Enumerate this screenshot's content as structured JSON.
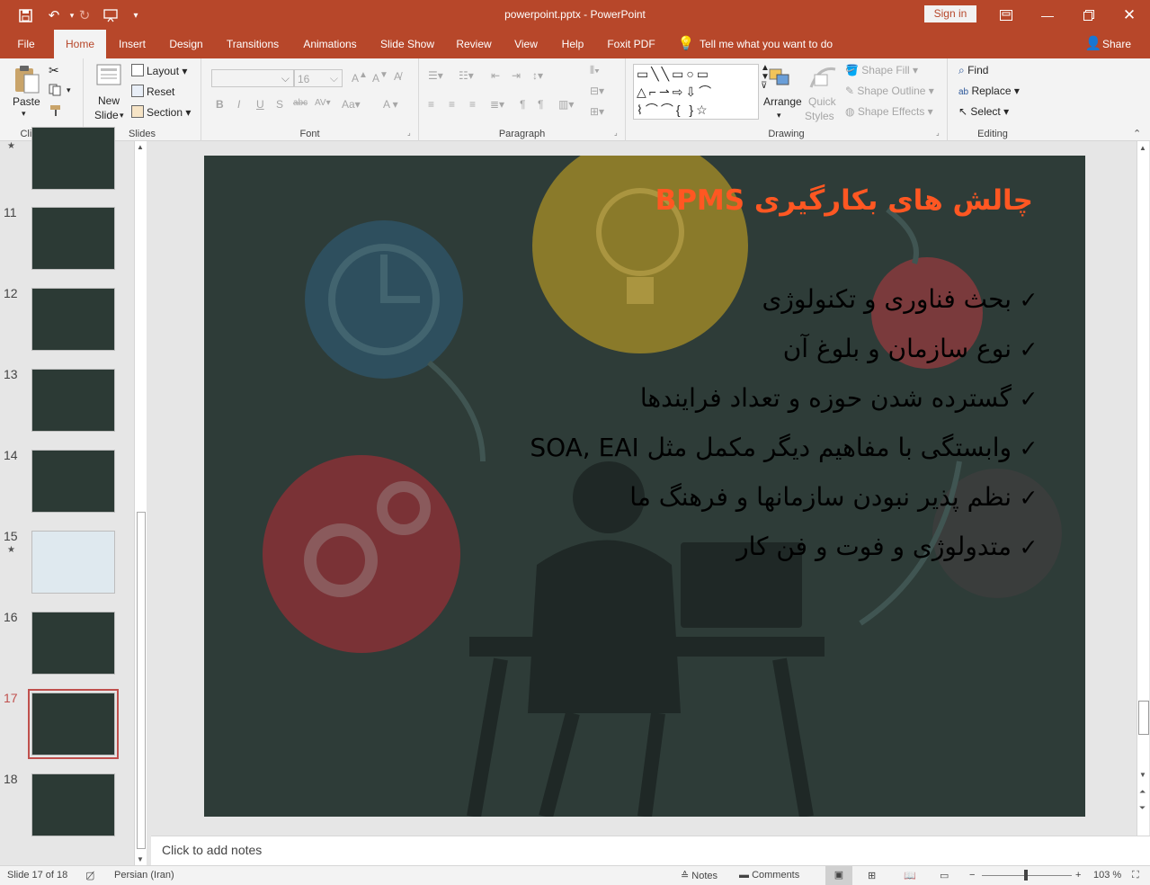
{
  "window": {
    "title": "powerpoint.pptx  -  PowerPoint",
    "sign_in": "Sign in"
  },
  "tabs": [
    {
      "label": "File"
    },
    {
      "label": "Home"
    },
    {
      "label": "Insert"
    },
    {
      "label": "Design"
    },
    {
      "label": "Transitions"
    },
    {
      "label": "Animations"
    },
    {
      "label": "Slide Show"
    },
    {
      "label": "Review"
    },
    {
      "label": "View"
    },
    {
      "label": "Help"
    },
    {
      "label": "Foxit PDF"
    }
  ],
  "tell_me": "Tell me what you want to do",
  "share": "Share",
  "ribbon": {
    "clipboard": {
      "paste": "Paste",
      "group": "Clipboard"
    },
    "slides": {
      "new_slide": "New",
      "new_slide2": "Slide",
      "layout": "Layout",
      "reset": "Reset",
      "section": "Section",
      "group": "Slides"
    },
    "font": {
      "size": "16",
      "group": "Font"
    },
    "paragraph": {
      "group": "Paragraph"
    },
    "drawing": {
      "arrange": "Arrange",
      "quick_styles": "Quick",
      "quick_styles2": "Styles",
      "shape_fill": "Shape Fill",
      "shape_outline": "Shape Outline",
      "shape_effects": "Shape Effects",
      "group": "Drawing"
    },
    "editing": {
      "find": "Find",
      "replace": "Replace",
      "select": "Select",
      "group": "Editing"
    }
  },
  "thumbnails": [
    {
      "num": "",
      "star": true
    },
    {
      "num": "11"
    },
    {
      "num": "12"
    },
    {
      "num": "13"
    },
    {
      "num": "14"
    },
    {
      "num": "15",
      "star": true
    },
    {
      "num": "16"
    },
    {
      "num": "17",
      "selected": true
    },
    {
      "num": "18"
    }
  ],
  "slide": {
    "title": "چالش های بکارگیری BPMS",
    "bullets": [
      "بحث فناوری و تکنولوژی ",
      "نوع سازمان و بلوغ آن",
      "گسترده شدن حوزه و تعداد فرایندها",
      "وابستگی با مفاهیم دیگر مکمل مثل SOA, EAI",
      "نظم پذیر نبودن سازمانها و فرهنگ ما",
      "متدولوژی و فوت و فن کار"
    ],
    "check_glyph": "✓"
  },
  "notes_placeholder": "Click to add notes",
  "status": {
    "slide_info": "Slide 17 of 18",
    "language": "Persian (Iran)",
    "notes": "Notes",
    "comments": "Comments",
    "zoom": "103 %"
  },
  "colors": {
    "accent": "#b7472a",
    "title": "#ff5722"
  }
}
